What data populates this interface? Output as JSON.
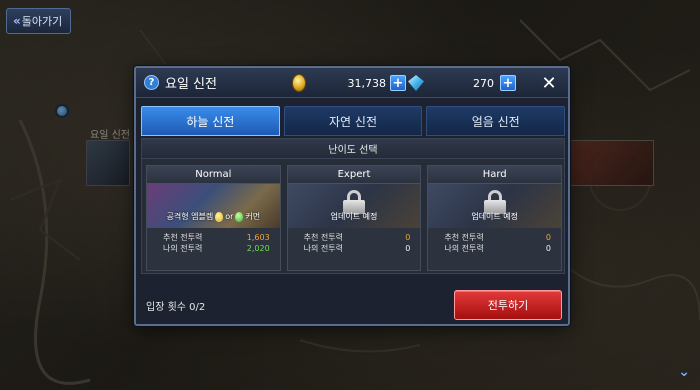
{
  "background": {
    "back_label": "돌아가기",
    "map_label": "요일 신전"
  },
  "dialog": {
    "title": "요일 신전",
    "currency": {
      "gold": "31,738",
      "gems": "270"
    },
    "tabs": [
      {
        "label": "하늘 신전",
        "active": true
      },
      {
        "label": "자연 신전",
        "active": false
      },
      {
        "label": "얼음 신전",
        "active": false
      }
    ],
    "panel_title": "난이도 선택",
    "difficulties": [
      {
        "name": "Normal",
        "locked": false,
        "reward_text": "공격형 엠블렘",
        "reward_or": "or",
        "reward_suffix": "커먼",
        "recommended_label": "추천 전투력",
        "recommended_value": "1,603",
        "my_label": "나의 전투력",
        "my_value": "2,020"
      },
      {
        "name": "Expert",
        "locked": true,
        "lock_text": "업데이트 예정",
        "recommended_label": "추천 전투력",
        "recommended_value": "0",
        "my_label": "나의 전투력",
        "my_value": "0"
      },
      {
        "name": "Hard",
        "locked": true,
        "lock_text": "업데이트 예정",
        "recommended_label": "추천 전투력",
        "recommended_value": "0",
        "my_label": "나의 전투력",
        "my_value": "0"
      }
    ],
    "entry_count": "입장 횟수 0/2",
    "battle_label": "전투하기"
  },
  "colors": {
    "active_tab": "#2f7fe0",
    "battle_button": "#d62a2a",
    "recommended_value": "#f0a23a",
    "my_value_ok": "#6be04a"
  }
}
